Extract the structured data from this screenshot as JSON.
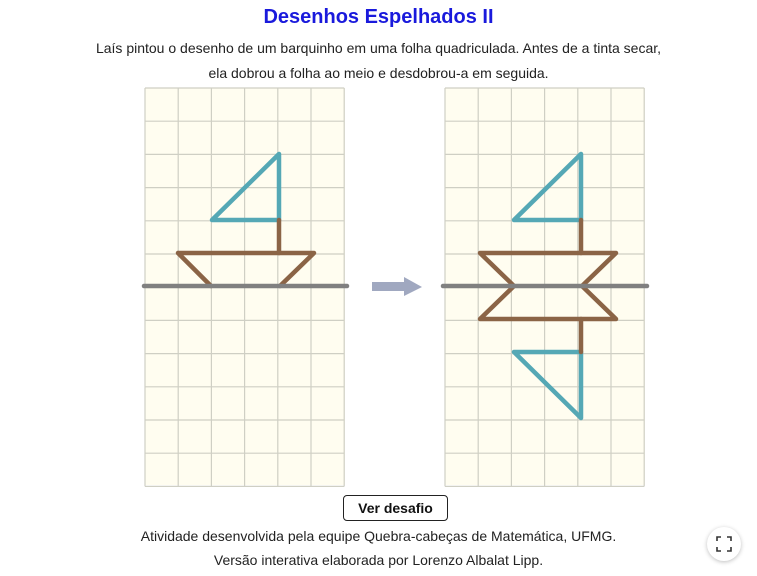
{
  "title": "Desenhos Espelhados II",
  "description": [
    "Laís pintou o desenho de um barquinho em uma folha quadriculada. Antes de a tinta secar,",
    "ela dobrou a folha ao meio e desdobrou-a em seguida."
  ],
  "button_label": "Ver desafio",
  "credits": [
    "Atividade desenvolvida pela equipe Quebra-cabeças de Matemática, UFMG.",
    "Versão interativa elaborada por Lorenzo Albalat Lipp."
  ],
  "colors": {
    "title": "#1a1adc",
    "paper": "#fffdf0",
    "grid": "#cfcfc4",
    "sail": "#55a8b5",
    "hull": "#8b6446",
    "fold": "#808080",
    "arrow": "#a0a8c0"
  },
  "icons": {
    "arrow": "right-arrow-icon",
    "fullscreen": "fullscreen-icon"
  }
}
